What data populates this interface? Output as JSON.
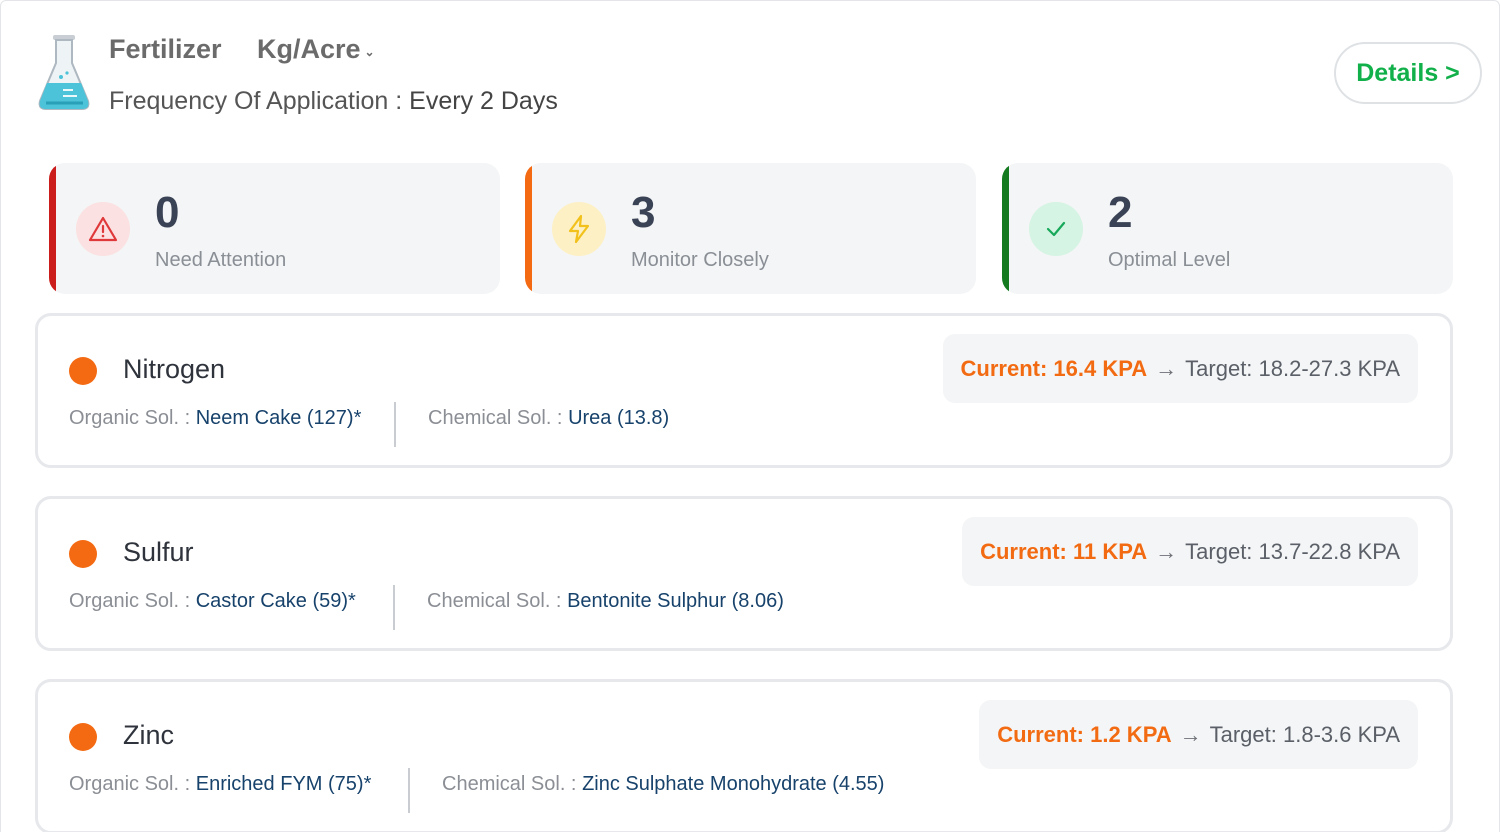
{
  "header": {
    "title": "Fertilizer",
    "unit": "Kg/Acre",
    "frequency_label": "Frequency Of Application :",
    "frequency_value": "Every 2 Days",
    "details_label": "Details >"
  },
  "icons": {
    "header": "flask-icon",
    "need_attention": "warning-triangle-icon",
    "monitor_closely": "lightning-bolt-icon",
    "optimal_level": "checkmark-icon",
    "unit_dropdown": "chevron-down-icon"
  },
  "colors": {
    "accent_green": "#12b04a",
    "attention_red": "#cc1d1d",
    "monitor_orange": "#f46a12",
    "optimal_green": "#137a1f",
    "current_value": "#f26b12",
    "solution_value": "#17426b"
  },
  "stats": [
    {
      "count": "0",
      "label": "Need Attention"
    },
    {
      "count": "3",
      "label": "Monitor Closely"
    },
    {
      "count": "2",
      "label": "Optimal Level"
    }
  ],
  "nutrients": [
    {
      "name": "Nitrogen",
      "organic_label": "Organic Sol. :",
      "organic_value": "Neem Cake (127)*",
      "chemical_label": "Chemical Sol. :",
      "chemical_value": "Urea (13.8)",
      "current": "Current: 16.4 KPA",
      "arrow": "→",
      "target": "Target: 18.2-27.3 KPA"
    },
    {
      "name": "Sulfur",
      "organic_label": "Organic Sol. :",
      "organic_value": "Castor Cake (59)*",
      "chemical_label": "Chemical Sol. :",
      "chemical_value": "Bentonite Sulphur (8.06)",
      "current": "Current: 11 KPA",
      "arrow": "→",
      "target": "Target: 13.7-22.8 KPA"
    },
    {
      "name": "Zinc",
      "organic_label": "Organic Sol. :",
      "organic_value": "Enriched FYM (75)*",
      "chemical_label": "Chemical Sol. :",
      "chemical_value": "Zinc Sulphate Monohydrate (4.55)",
      "current": "Current: 1.2 KPA",
      "arrow": "→",
      "target": "Target: 1.8-3.6 KPA"
    }
  ]
}
